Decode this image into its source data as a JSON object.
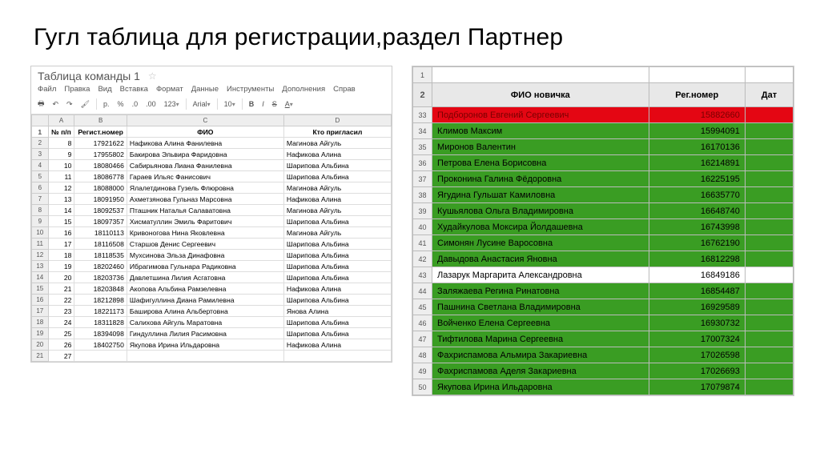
{
  "slide": {
    "title": "Гугл таблица для регистрации,раздел Партнер"
  },
  "left": {
    "doc_title": "Таблица команды 1",
    "menu": [
      "Файл",
      "Правка",
      "Вид",
      "Вставка",
      "Формат",
      "Данные",
      "Инструменты",
      "Дополнения",
      "Справ"
    ],
    "toolbar": {
      "format_currency": "р.",
      "format_percent": "%",
      "format_decdec": ".0",
      "format_incdec": ".00",
      "format_more": "123",
      "font": "Arial",
      "font_size": "10"
    },
    "col_letters": [
      "A",
      "B",
      "C",
      "D"
    ],
    "header_row": [
      "№ п/п",
      "Регист.номер",
      "ФИО",
      "Кто пригласил"
    ],
    "rows": [
      {
        "rn": "2",
        "n": "8",
        "reg": "17921622",
        "fio": "Нафикова Алина Фанилевна",
        "who": "Магинова Айгуль"
      },
      {
        "rn": "3",
        "n": "9",
        "reg": "17955802",
        "fio": "Бакирова Эльвира Фаридовна",
        "who": "Нафикова Алина"
      },
      {
        "rn": "4",
        "n": "10",
        "reg": "18080466",
        "fio": "Сабирьянова Лиана Фанилевна",
        "who": "Шарипова Альбина"
      },
      {
        "rn": "5",
        "n": "11",
        "reg": "18086778",
        "fio": "Гараев Ильяс Фанисович",
        "who": "Шарипова Альбина"
      },
      {
        "rn": "6",
        "n": "12",
        "reg": "18088000",
        "fio": "Ялалетдинова Гузель Флюровна",
        "who": "Магинова Айгуль"
      },
      {
        "rn": "7",
        "n": "13",
        "reg": "18091950",
        "fio": "Ахметзянова Гульназ Марсовна",
        "who": "Нафикова Алина"
      },
      {
        "rn": "8",
        "n": "14",
        "reg": "18092537",
        "fio": "Пташник Наталья Салаватовна",
        "who": "Магинова Айгуль"
      },
      {
        "rn": "9",
        "n": "15",
        "reg": "18097357",
        "fio": "Хисматуллин Эмиль Фаритович",
        "who": "Шарипова Альбина"
      },
      {
        "rn": "10",
        "n": "16",
        "reg": "18110113",
        "fio": "Кривоногова Нина Яковлевна",
        "who": "Магинова Айгуль"
      },
      {
        "rn": "11",
        "n": "17",
        "reg": "18116508",
        "fio": "Старшов Денис Сергеевич",
        "who": "Шарипова Альбина"
      },
      {
        "rn": "12",
        "n": "18",
        "reg": "18118535",
        "fio": "Мухсинова Эльза Динафовна",
        "who": "Шарипова Альбина"
      },
      {
        "rn": "13",
        "n": "19",
        "reg": "18202460",
        "fio": "Ибрагимова Гульнара Радиковна",
        "who": "Шарипова Альбина"
      },
      {
        "rn": "14",
        "n": "20",
        "reg": "18203736",
        "fio": "Давлетшина Лилия Асгатовна",
        "who": "Шарипова Альбина"
      },
      {
        "rn": "15",
        "n": "21",
        "reg": "18203848",
        "fio": "Акопова Альбина Рамзелевна",
        "who": "Нафикова Алина"
      },
      {
        "rn": "16",
        "n": "22",
        "reg": "18212898",
        "fio": "Шафигуллина Диана Рамилевна",
        "who": "Шарипова Альбина"
      },
      {
        "rn": "17",
        "n": "23",
        "reg": "18221173",
        "fio": "Баширова Алина Альбертовна",
        "who": "Янова Алина"
      },
      {
        "rn": "18",
        "n": "24",
        "reg": "18311828",
        "fio": "Салихова Айгуль Маратовна",
        "who": "Шарипова Альбина"
      },
      {
        "rn": "19",
        "n": "25",
        "reg": "18394098",
        "fio": "Гиндуллина Лилия Расимовна",
        "who": "Шарипова Альбина"
      },
      {
        "rn": "20",
        "n": "26",
        "reg": "18402750",
        "fio": "Якупова Ирина Ильдаровна",
        "who": "Нафикова Алина"
      },
      {
        "rn": "21",
        "n": "27",
        "reg": "",
        "fio": "",
        "who": ""
      }
    ]
  },
  "right": {
    "top_rownum": "1",
    "header_rownum": "2",
    "header": [
      "ФИО новичка",
      "Рег.номер",
      "Дат"
    ],
    "rows": [
      {
        "rn": "33",
        "cls": "red",
        "name": "Подборонов Евгений Сергеевич",
        "reg": "15882660"
      },
      {
        "rn": "34",
        "cls": "green",
        "name": "Климов Максим",
        "reg": "15994091"
      },
      {
        "rn": "35",
        "cls": "green",
        "name": "Миронов Валентин",
        "reg": "16170136"
      },
      {
        "rn": "36",
        "cls": "green",
        "name": "Петрова Елена Борисовна",
        "reg": "16214891"
      },
      {
        "rn": "37",
        "cls": "green",
        "name": "Проконина Галина Фёдоровна",
        "reg": "16225195"
      },
      {
        "rn": "38",
        "cls": "green",
        "name": "Ягудина Гульшат Камиловна",
        "reg": "16635770"
      },
      {
        "rn": "39",
        "cls": "green",
        "name": "Кушьялова Ольга Владимировна",
        "reg": "16648740"
      },
      {
        "rn": "40",
        "cls": "green",
        "name": "Худайкулова Моксира Йолдашевна",
        "reg": "16743998"
      },
      {
        "rn": "41",
        "cls": "green",
        "name": "Симонян Лусине Варосовна",
        "reg": "16762190"
      },
      {
        "rn": "42",
        "cls": "green",
        "name": "Давыдова Анастасия Яновна",
        "reg": "16812298"
      },
      {
        "rn": "43",
        "cls": "white",
        "name": "Лазарук Маргарита Александровна",
        "reg": "16849186"
      },
      {
        "rn": "44",
        "cls": "green",
        "name": "Заляжаева Регина Ринатовна",
        "reg": "16854487"
      },
      {
        "rn": "45",
        "cls": "green",
        "name": "Пашнина Светлана Владимировна",
        "reg": "16929589"
      },
      {
        "rn": "46",
        "cls": "green",
        "name": "Войченко Елена Сергеевна",
        "reg": "16930732"
      },
      {
        "rn": "47",
        "cls": "green",
        "name": "Тифтилова Марина Сергеевна",
        "reg": "17007324"
      },
      {
        "rn": "48",
        "cls": "green",
        "name": "Фахриспамова Альмира  Закариевна",
        "reg": "17026598"
      },
      {
        "rn": "49",
        "cls": "green",
        "name": "Фахриспамова Аделя Закариевна",
        "reg": "17026693"
      },
      {
        "rn": "50",
        "cls": "green",
        "name": "Якупова Ирина Ильдаровна",
        "reg": "17079874"
      }
    ]
  }
}
